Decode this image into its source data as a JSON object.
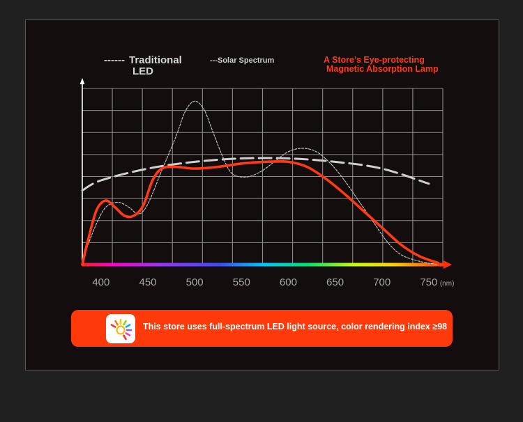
{
  "legend": {
    "led_dash": "------",
    "led_line1": "Traditional",
    "led_line2": "LED",
    "solar": "---Solar Spectrum",
    "store_line1": "A Store's Eye-protecting",
    "store_line2": "Magnetic Absorption Lamp"
  },
  "banner": {
    "text": "This store uses full-spectrum LED light source, color rendering index ≥98",
    "icon": "sun-rays-icon"
  },
  "chart_data": {
    "type": "line",
    "xlabel": "",
    "ylabel": "",
    "x_unit": "(nm)",
    "x_ticks": [
      "400",
      "450",
      "500",
      "550",
      "600",
      "650",
      "700",
      "750"
    ],
    "xlim": [
      380,
      765
    ],
    "ylim": [
      0,
      100
    ],
    "grid": true,
    "series": [
      {
        "name": "Traditional LED",
        "style": "dashed",
        "color": "#d0d0d0",
        "points": [
          [
            380,
            44
          ],
          [
            400,
            50
          ],
          [
            450,
            57
          ],
          [
            500,
            61
          ],
          [
            550,
            63
          ],
          [
            600,
            63
          ],
          [
            650,
            61
          ],
          [
            700,
            57
          ],
          [
            750,
            48
          ]
        ]
      },
      {
        "name": "Solar Spectrum",
        "style": "dotted",
        "color": "#bdbdbd",
        "points": [
          [
            380,
            0
          ],
          [
            385,
            10
          ],
          [
            395,
            24
          ],
          [
            405,
            34
          ],
          [
            418,
            37
          ],
          [
            430,
            34
          ],
          [
            440,
            30
          ],
          [
            450,
            36
          ],
          [
            465,
            56
          ],
          [
            480,
            76
          ],
          [
            490,
            91
          ],
          [
            500,
            97
          ],
          [
            510,
            92
          ],
          [
            520,
            78
          ],
          [
            530,
            64
          ],
          [
            540,
            54
          ],
          [
            555,
            52
          ],
          [
            570,
            55
          ],
          [
            585,
            61
          ],
          [
            600,
            67
          ],
          [
            615,
            69
          ],
          [
            630,
            67
          ],
          [
            645,
            60
          ],
          [
            660,
            50
          ],
          [
            675,
            38
          ],
          [
            690,
            26
          ],
          [
            705,
            14
          ],
          [
            720,
            6
          ],
          [
            740,
            2
          ],
          [
            760,
            0
          ]
        ]
      },
      {
        "name": "A Store's Eye-protecting Magnetic Absorption Lamp",
        "style": "solid",
        "color": "#ff3a14",
        "points": [
          [
            380,
            0
          ],
          [
            385,
            12
          ],
          [
            395,
            32
          ],
          [
            405,
            38
          ],
          [
            415,
            34
          ],
          [
            425,
            29
          ],
          [
            435,
            29
          ],
          [
            445,
            35
          ],
          [
            455,
            50
          ],
          [
            465,
            57
          ],
          [
            480,
            58
          ],
          [
            500,
            57
          ],
          [
            525,
            58
          ],
          [
            550,
            60
          ],
          [
            575,
            61
          ],
          [
            600,
            61
          ],
          [
            620,
            58
          ],
          [
            640,
            51
          ],
          [
            660,
            42
          ],
          [
            680,
            32
          ],
          [
            700,
            22
          ],
          [
            720,
            12
          ],
          [
            740,
            5
          ],
          [
            760,
            1
          ]
        ]
      }
    ],
    "colors": {
      "spectrum_bar": "rainbow",
      "axes": "#ffffff",
      "grid": "#9a9a9a",
      "accent": "#ff3a0a"
    }
  }
}
